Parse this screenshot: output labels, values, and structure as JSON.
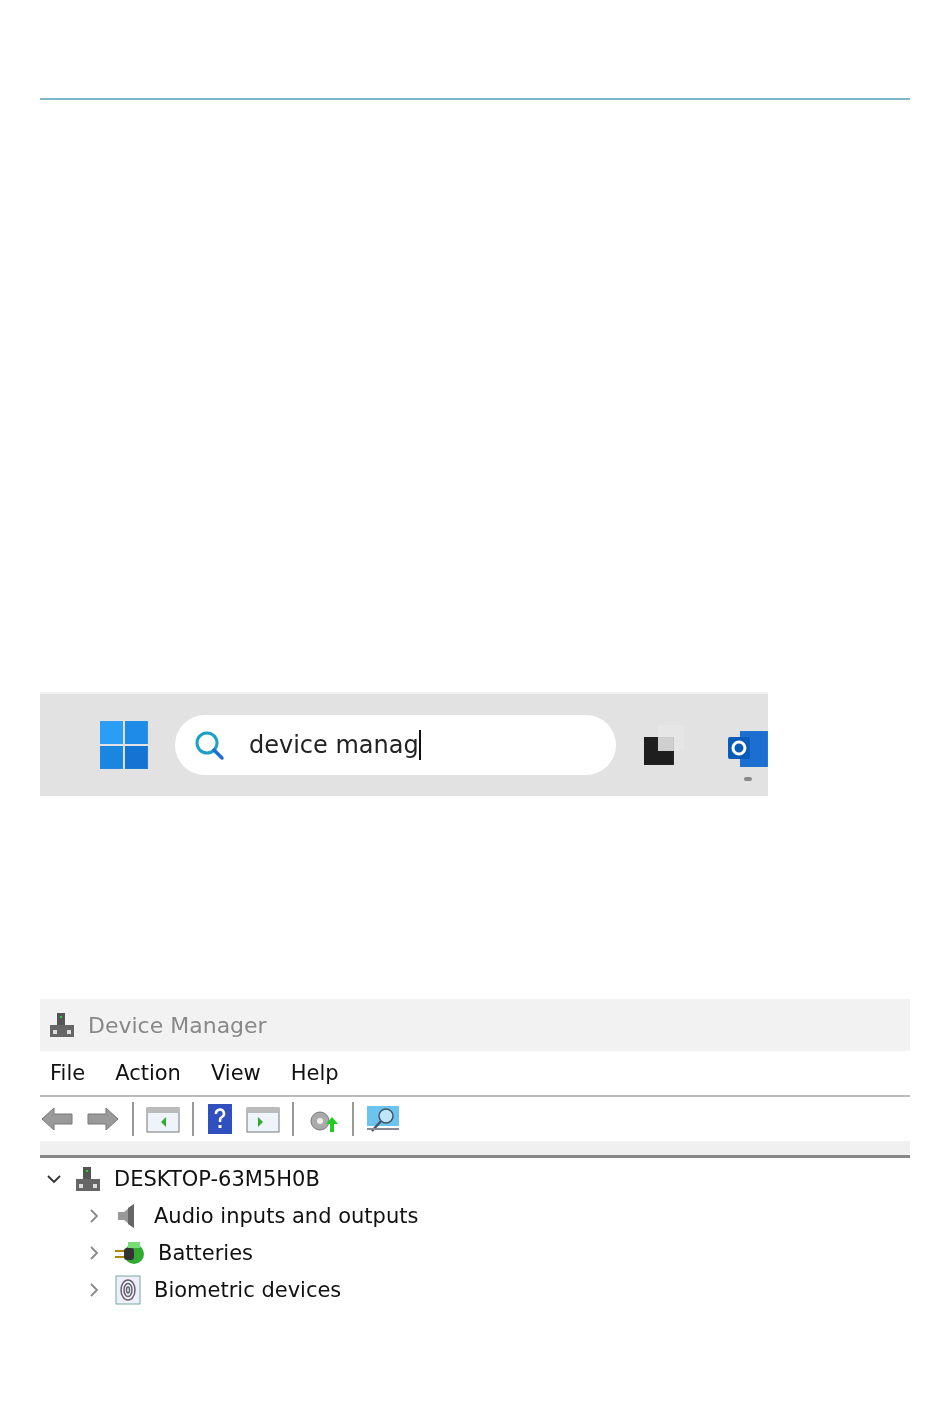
{
  "taskbar": {
    "search": {
      "value": "device manag"
    }
  },
  "device_manager": {
    "window": {
      "title": "Device Manager"
    },
    "menu": [
      "File",
      "Action",
      "View",
      "Help"
    ],
    "tree": {
      "label": "DESKTOP-63M5H0B",
      "kind": "computer",
      "expanded": true,
      "children": [
        {
          "label": "Audio inputs and outputs",
          "kind": "audio",
          "expanded": false
        },
        {
          "label": "Batteries",
          "kind": "battery",
          "expanded": false
        },
        {
          "label": "Biometric devices",
          "kind": "biometric",
          "expanded": false
        }
      ]
    }
  }
}
